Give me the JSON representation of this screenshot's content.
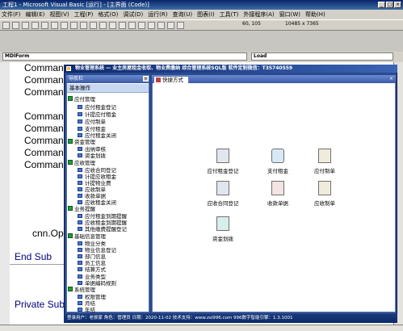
{
  "ide": {
    "title": "工程1 - Microsoft Visual Basic [运行] - [主界面 (Code)]",
    "menu": [
      "文件(F)",
      "编辑(E)",
      "视图(V)",
      "工程(P)",
      "格式(O)",
      "调试(D)",
      "运行(R)",
      "查询(U)",
      "图表(I)",
      "工具(T)",
      "外接程序(A)",
      "窗口(W)",
      "帮助(H)"
    ],
    "position": "60, 105",
    "size": "10485 x 7365",
    "object_combo": "MDIForm",
    "proc_combo": "Load",
    "code_lines": [
      "Comman",
      "Comman",
      "Comman",
      "Comman",
      "Comman",
      "Comman",
      "Comman",
      "Comman",
      "cnn.Ope",
      "End Sub",
      "Private Sub"
    ]
  },
  "app": {
    "title": "物业管理系统 — 业主房屋租金收取、物业费缴纳 综合管理系统SQL版 软件定制微信：T35740559",
    "nav_title": "导航栏",
    "nav_close": "×",
    "nav_section": "基本操作",
    "groups": [
      {
        "label": "应付管理",
        "items": [
          "应付租金登记",
          "计提应付租金",
          "应付制单",
          "支付租金",
          "应付租金关闭"
        ]
      },
      {
        "label": "资金管理",
        "items": [
          "出纳审核",
          "资金划拨"
        ]
      },
      {
        "label": "应收管理",
        "items": [
          "应收合同登记",
          "计提应收租金",
          "计提物业费",
          "应收制单",
          "收款单据",
          "应收租金关闭"
        ]
      },
      {
        "label": "业务提醒",
        "items": [
          "应付租金到期提醒",
          "应收租金到期提醒",
          "其他缴费提醒登记"
        ]
      },
      {
        "label": "基础信息管理",
        "items": [
          "物业分类",
          "物业信息登记",
          "部门信息",
          "员工信息",
          "结算方式",
          "业务类型",
          "单据编码规则"
        ]
      },
      {
        "label": "系统管理",
        "items": [
          "权限管理",
          "月结",
          "年结"
        ]
      }
    ],
    "quick_tab": "快捷方式",
    "quick_close": "×",
    "shortcuts": [
      "应付租金登记",
      "支付租金",
      "应付制单",
      "应收合同登记",
      "收款单据",
      "应收制单",
      "资金划拨"
    ],
    "status": "登录用户：老侯家  角色：管理员  日期：2020-11-02  技术支持：www.zsi996.com  996数字智能引擎：1.3.1001"
  }
}
